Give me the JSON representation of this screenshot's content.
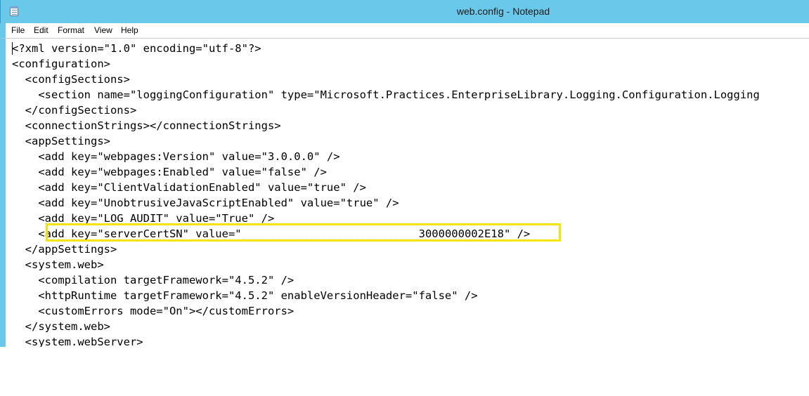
{
  "window": {
    "title": "web.config - Notepad"
  },
  "menu": [
    "File",
    "Edit",
    "Format",
    "View",
    "Help"
  ],
  "editor": {
    "lines": [
      "<?xml version=\"1.0\" encoding=\"utf-8\"?>",
      "<configuration>",
      "  <configSections>",
      "    <section name=\"loggingConfiguration\" type=\"Microsoft.Practices.EnterpriseLibrary.Logging.Configuration.Logging",
      "  </configSections>",
      "  <connectionStrings></connectionStrings>",
      "  <appSettings>",
      "    <add key=\"webpages:Version\" value=\"3.0.0.0\" />",
      "    <add key=\"webpages:Enabled\" value=\"false\" />",
      "    <add key=\"ClientValidationEnabled\" value=\"true\" />",
      "    <add key=\"UnobtrusiveJavaScriptEnabled\" value=\"true\" />",
      "    <add key=\"LOG_AUDIT\" value=\"True\" />",
      "",
      "  </appSettings>",
      "  <system.web>",
      "    <compilation targetFramework=\"4.5.2\" />",
      "    <httpRuntime targetFramework=\"4.5.2\" enableVersionHeader=\"false\" />",
      "    <customErrors mode=\"On\"></customErrors>",
      "  </system.web>",
      "  <system.webServer>"
    ],
    "highlighted_line": {
      "prefix": "    <add key=\"serverCertSN\" value=\"",
      "suffix": "3000000002E18\" />"
    }
  },
  "colors": {
    "titlebar": "#6ac9ea",
    "highlight_border": "#f5e400"
  }
}
